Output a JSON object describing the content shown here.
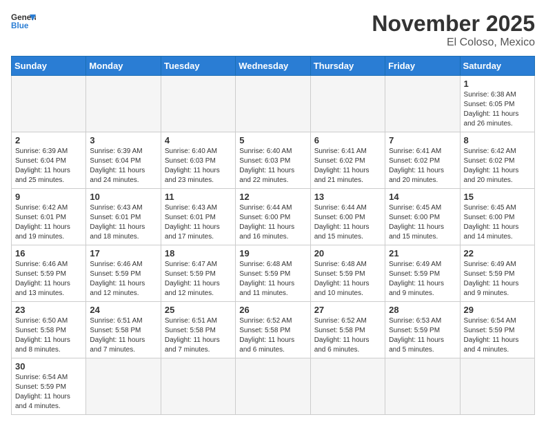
{
  "header": {
    "logo_general": "General",
    "logo_blue": "Blue",
    "month": "November 2025",
    "location": "El Coloso, Mexico"
  },
  "days_of_week": [
    "Sunday",
    "Monday",
    "Tuesday",
    "Wednesday",
    "Thursday",
    "Friday",
    "Saturday"
  ],
  "weeks": [
    [
      {
        "day": "",
        "info": ""
      },
      {
        "day": "",
        "info": ""
      },
      {
        "day": "",
        "info": ""
      },
      {
        "day": "",
        "info": ""
      },
      {
        "day": "",
        "info": ""
      },
      {
        "day": "",
        "info": ""
      },
      {
        "day": "1",
        "info": "Sunrise: 6:38 AM\nSunset: 6:05 PM\nDaylight: 11 hours\nand 26 minutes."
      }
    ],
    [
      {
        "day": "2",
        "info": "Sunrise: 6:39 AM\nSunset: 6:04 PM\nDaylight: 11 hours\nand 25 minutes."
      },
      {
        "day": "3",
        "info": "Sunrise: 6:39 AM\nSunset: 6:04 PM\nDaylight: 11 hours\nand 24 minutes."
      },
      {
        "day": "4",
        "info": "Sunrise: 6:40 AM\nSunset: 6:03 PM\nDaylight: 11 hours\nand 23 minutes."
      },
      {
        "day": "5",
        "info": "Sunrise: 6:40 AM\nSunset: 6:03 PM\nDaylight: 11 hours\nand 22 minutes."
      },
      {
        "day": "6",
        "info": "Sunrise: 6:41 AM\nSunset: 6:02 PM\nDaylight: 11 hours\nand 21 minutes."
      },
      {
        "day": "7",
        "info": "Sunrise: 6:41 AM\nSunset: 6:02 PM\nDaylight: 11 hours\nand 20 minutes."
      },
      {
        "day": "8",
        "info": "Sunrise: 6:42 AM\nSunset: 6:02 PM\nDaylight: 11 hours\nand 20 minutes."
      }
    ],
    [
      {
        "day": "9",
        "info": "Sunrise: 6:42 AM\nSunset: 6:01 PM\nDaylight: 11 hours\nand 19 minutes."
      },
      {
        "day": "10",
        "info": "Sunrise: 6:43 AM\nSunset: 6:01 PM\nDaylight: 11 hours\nand 18 minutes."
      },
      {
        "day": "11",
        "info": "Sunrise: 6:43 AM\nSunset: 6:01 PM\nDaylight: 11 hours\nand 17 minutes."
      },
      {
        "day": "12",
        "info": "Sunrise: 6:44 AM\nSunset: 6:00 PM\nDaylight: 11 hours\nand 16 minutes."
      },
      {
        "day": "13",
        "info": "Sunrise: 6:44 AM\nSunset: 6:00 PM\nDaylight: 11 hours\nand 15 minutes."
      },
      {
        "day": "14",
        "info": "Sunrise: 6:45 AM\nSunset: 6:00 PM\nDaylight: 11 hours\nand 15 minutes."
      },
      {
        "day": "15",
        "info": "Sunrise: 6:45 AM\nSunset: 6:00 PM\nDaylight: 11 hours\nand 14 minutes."
      }
    ],
    [
      {
        "day": "16",
        "info": "Sunrise: 6:46 AM\nSunset: 5:59 PM\nDaylight: 11 hours\nand 13 minutes."
      },
      {
        "day": "17",
        "info": "Sunrise: 6:46 AM\nSunset: 5:59 PM\nDaylight: 11 hours\nand 12 minutes."
      },
      {
        "day": "18",
        "info": "Sunrise: 6:47 AM\nSunset: 5:59 PM\nDaylight: 11 hours\nand 12 minutes."
      },
      {
        "day": "19",
        "info": "Sunrise: 6:48 AM\nSunset: 5:59 PM\nDaylight: 11 hours\nand 11 minutes."
      },
      {
        "day": "20",
        "info": "Sunrise: 6:48 AM\nSunset: 5:59 PM\nDaylight: 11 hours\nand 10 minutes."
      },
      {
        "day": "21",
        "info": "Sunrise: 6:49 AM\nSunset: 5:59 PM\nDaylight: 11 hours\nand 9 minutes."
      },
      {
        "day": "22",
        "info": "Sunrise: 6:49 AM\nSunset: 5:59 PM\nDaylight: 11 hours\nand 9 minutes."
      }
    ],
    [
      {
        "day": "23",
        "info": "Sunrise: 6:50 AM\nSunset: 5:58 PM\nDaylight: 11 hours\nand 8 minutes."
      },
      {
        "day": "24",
        "info": "Sunrise: 6:51 AM\nSunset: 5:58 PM\nDaylight: 11 hours\nand 7 minutes."
      },
      {
        "day": "25",
        "info": "Sunrise: 6:51 AM\nSunset: 5:58 PM\nDaylight: 11 hours\nand 7 minutes."
      },
      {
        "day": "26",
        "info": "Sunrise: 6:52 AM\nSunset: 5:58 PM\nDaylight: 11 hours\nand 6 minutes."
      },
      {
        "day": "27",
        "info": "Sunrise: 6:52 AM\nSunset: 5:58 PM\nDaylight: 11 hours\nand 6 minutes."
      },
      {
        "day": "28",
        "info": "Sunrise: 6:53 AM\nSunset: 5:59 PM\nDaylight: 11 hours\nand 5 minutes."
      },
      {
        "day": "29",
        "info": "Sunrise: 6:54 AM\nSunset: 5:59 PM\nDaylight: 11 hours\nand 4 minutes."
      }
    ],
    [
      {
        "day": "30",
        "info": "Sunrise: 6:54 AM\nSunset: 5:59 PM\nDaylight: 11 hours\nand 4 minutes."
      },
      {
        "day": "",
        "info": ""
      },
      {
        "day": "",
        "info": ""
      },
      {
        "day": "",
        "info": ""
      },
      {
        "day": "",
        "info": ""
      },
      {
        "day": "",
        "info": ""
      },
      {
        "day": "",
        "info": ""
      }
    ]
  ]
}
